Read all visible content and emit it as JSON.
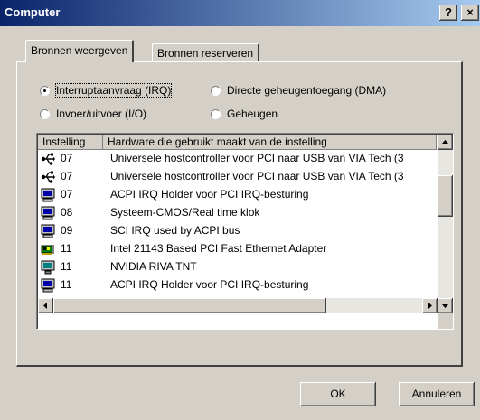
{
  "window": {
    "title": "Computer",
    "help_label": "?",
    "close_label": "×"
  },
  "tabs": [
    {
      "label": "Bronnen weergeven",
      "active": true
    },
    {
      "label": "Bronnen reserveren",
      "active": false
    }
  ],
  "radios": [
    {
      "label": "Interruptaanvraag (IRQ)",
      "checked": true
    },
    {
      "label": "Directe geheugentoegang (DMA)",
      "checked": false
    },
    {
      "label": "Invoer/uitvoer (I/O)",
      "checked": false
    },
    {
      "label": "Geheugen",
      "checked": false
    }
  ],
  "list": {
    "columns": [
      "Instelling",
      "Hardware die gebruikt maakt van de instelling"
    ],
    "rows": [
      {
        "icon": "usb-icon",
        "setting": "07",
        "description": "Universele hostcontroller voor PCI naar USB van VIA Tech (3"
      },
      {
        "icon": "usb-icon",
        "setting": "07",
        "description": "Universele hostcontroller voor PCI naar USB van VIA Tech (3"
      },
      {
        "icon": "computer-icon",
        "setting": "07",
        "description": "ACPI IRQ Holder voor PCI IRQ-besturing"
      },
      {
        "icon": "computer-icon",
        "setting": "08",
        "description": "Systeem-CMOS/Real time klok"
      },
      {
        "icon": "computer-icon",
        "setting": "09",
        "description": "SCI IRQ used by ACPI bus"
      },
      {
        "icon": "network-card-icon",
        "setting": "11",
        "description": "Intel 21143 Based PCI Fast Ethernet Adapter"
      },
      {
        "icon": "monitor-icon",
        "setting": "11",
        "description": "NVIDIA RIVA TNT"
      },
      {
        "icon": "computer-icon",
        "setting": "11",
        "description": "ACPI IRQ Holder voor PCI IRQ-besturing"
      }
    ]
  },
  "buttons": {
    "ok": "OK",
    "cancel": "Annuleren"
  },
  "colors": {
    "title_start": "#0a246a",
    "title_end": "#a6caf0",
    "face": "#d4d0c8"
  }
}
